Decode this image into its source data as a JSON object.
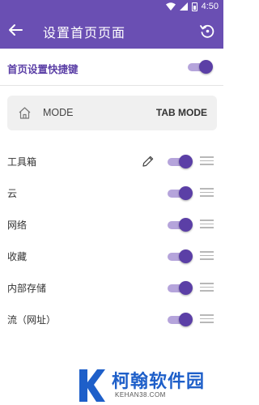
{
  "status_bar": {
    "time": "4:50",
    "icons": [
      "wifi-icon",
      "signal-icon",
      "battery-icon"
    ]
  },
  "app_bar": {
    "title": "设置首页页面",
    "back_icon": "arrow-left-icon",
    "action_icon": "restore-icon"
  },
  "quick_setting": {
    "label": "首页设置快捷键",
    "enabled": true
  },
  "mode": {
    "icon": "home-icon",
    "label": "MODE",
    "value": "TAB MODE"
  },
  "items": [
    {
      "label": "工具箱",
      "enabled": true,
      "editable": true
    },
    {
      "label": "云",
      "enabled": true,
      "editable": false
    },
    {
      "label": "网络",
      "enabled": true,
      "editable": false
    },
    {
      "label": "收藏",
      "enabled": true,
      "editable": false
    },
    {
      "label": "内部存储",
      "enabled": true,
      "editable": false
    },
    {
      "label": "流（网址）",
      "enabled": true,
      "editable": false
    }
  ],
  "watermark": {
    "text": "柯翰软件园",
    "url": "KEHAN38.COM"
  },
  "colors": {
    "primary": "#6a4fb3",
    "accent": "#5b3fa6",
    "track": "#b5a4db",
    "brand_blue": "#1e5fc9"
  }
}
